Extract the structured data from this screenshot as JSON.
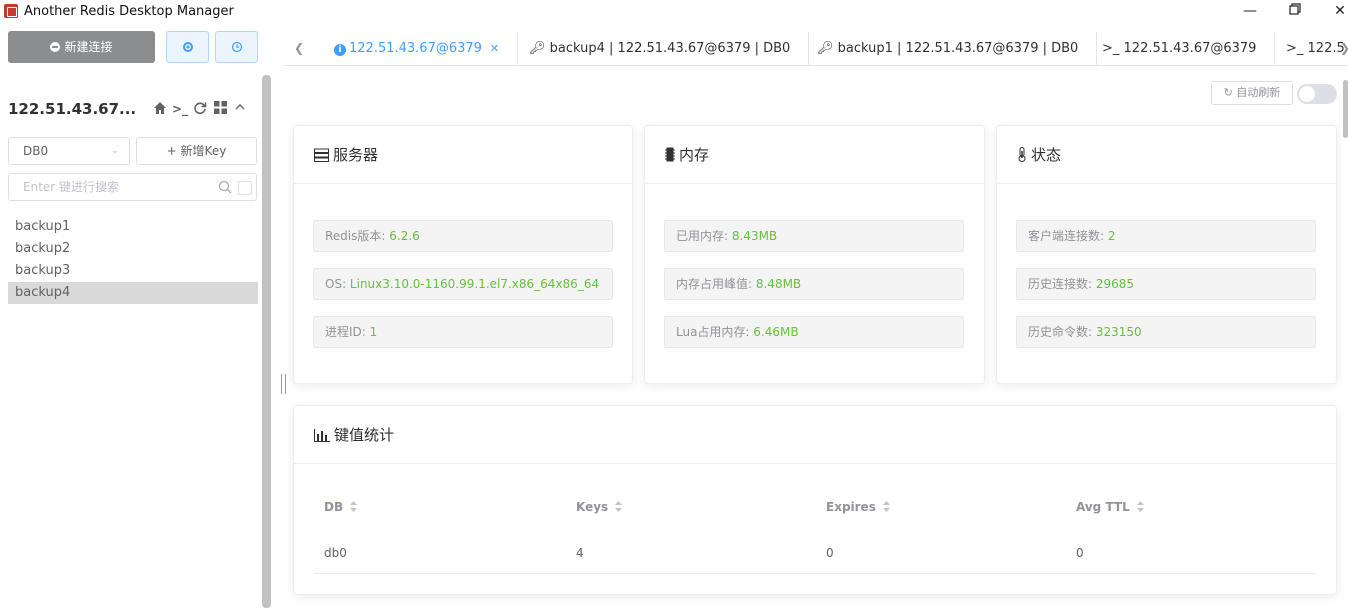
{
  "window": {
    "title": "Another Redis Desktop Manager"
  },
  "sidebar": {
    "new_connection_label": "新建连接",
    "connection_name": "122.51.43.67...",
    "db_select": "DB0",
    "add_key_label": "+ 新增Key",
    "search_placeholder": "Enter 键进行搜索",
    "keys": [
      "backup1",
      "backup2",
      "backup3",
      "backup4"
    ],
    "selected_key": "backup4"
  },
  "tabs": [
    {
      "label": "122.51.43.67@6379",
      "active": true,
      "icon": "info-icon"
    },
    {
      "label": "backup4 | 122.51.43.67@6379 | DB0",
      "icon": "key-icon"
    },
    {
      "label": "backup1 | 122.51.43.67@6379 | DB0",
      "icon": "key-icon"
    },
    {
      "label": ">_ 122.51.43.67@6379",
      "icon": "terminal-icon"
    },
    {
      "label": ">_ 122.5",
      "icon": "terminal-icon"
    }
  ],
  "toolbar": {
    "auto_refresh_label": "自动刷新",
    "auto_refresh_on": false
  },
  "server": {
    "title": "服务器",
    "redis_version_label": "Redis版本: ",
    "redis_version": "6.2.6",
    "os_label": "OS: ",
    "os": "Linux3.10.0-1160.99.1.el7.x86_64x86_64",
    "pid_label": "进程ID: ",
    "pid": "1"
  },
  "memory": {
    "title": "内存",
    "used_label": "已用内存: ",
    "used": "8.43MB",
    "peak_label": "内存占用峰值: ",
    "peak": "8.48MB",
    "lua_label": "Lua占用内存: ",
    "lua": "6.46MB"
  },
  "status": {
    "title": "状态",
    "clients_label": "客户端连接数: ",
    "clients": "2",
    "connections_label": "历史连接数: ",
    "connections": "29685",
    "commands_label": "历史命令数: ",
    "commands": "323150"
  },
  "keyspace": {
    "title": "键值统计",
    "columns": [
      "DB",
      "Keys",
      "Expires",
      "Avg TTL"
    ],
    "rows": [
      {
        "db": "db0",
        "keys": "4",
        "expires": "0",
        "avg_ttl": "0"
      }
    ]
  },
  "colors": {
    "accent": "#409eff",
    "value_green": "#67c23a",
    "button_gray": "#8c8d8f"
  }
}
